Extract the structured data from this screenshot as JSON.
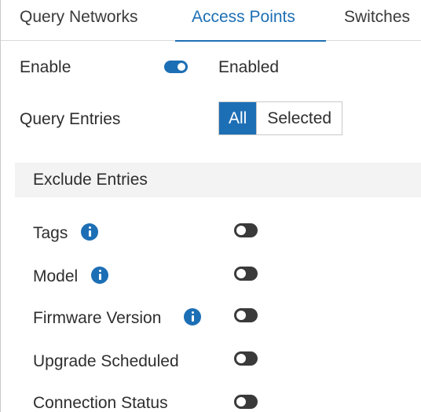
{
  "tabs": [
    {
      "label": "Query Networks"
    },
    {
      "label": "Access Points"
    },
    {
      "label": "Switches"
    }
  ],
  "enable": {
    "label": "Enable",
    "status": "Enabled",
    "on": true
  },
  "query_entries": {
    "label": "Query Entries",
    "options": [
      "All",
      "Selected"
    ],
    "selected": "All"
  },
  "exclude": {
    "title": "Exclude Entries",
    "items": [
      {
        "label": "Tags",
        "info": true,
        "on": false
      },
      {
        "label": "Model",
        "info": true,
        "on": false
      },
      {
        "label": "Firmware Version",
        "info": true,
        "on": false
      },
      {
        "label": "Upgrade Scheduled",
        "info": false,
        "on": false
      },
      {
        "label": "Connection Status",
        "info": false,
        "on": false
      }
    ]
  },
  "colors": {
    "accent": "#1d6fb5",
    "toggle_off": "#3a3a3a",
    "band": "#f3f3f3"
  }
}
